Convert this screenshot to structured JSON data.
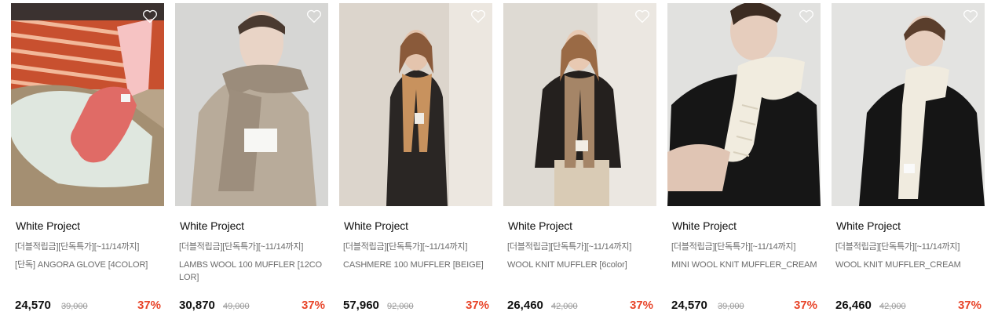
{
  "icons": {
    "wishlist": "heart-outline-icon"
  },
  "colors": {
    "discount": "#e8452a",
    "text": "#111111",
    "muted": "#6b6b6b",
    "strike": "#9a9a9a"
  },
  "products": [
    {
      "brand": "White Project",
      "promo": "[더블적립금][단독특가][~11/14까지]",
      "title": "[단독] ANGORA GLOVE [4COLOR]",
      "price": "24,570",
      "original_price": "39,000",
      "discount": "37%"
    },
    {
      "brand": "White Project",
      "promo": "[더블적립금][단독특가][~11/14까지]",
      "title": "LAMBS WOOL 100 MUFFLER [12COLOR]",
      "price": "30,870",
      "original_price": "49,000",
      "discount": "37%"
    },
    {
      "brand": "White Project",
      "promo": "[더블적립금][단독특가][~11/14까지]",
      "title": "CASHMERE 100 MUFFLER [BEIGE]",
      "price": "57,960",
      "original_price": "92,000",
      "discount": "37%"
    },
    {
      "brand": "White Project",
      "promo": "[더블적립금][단독특가][~11/14까지]",
      "title": "WOOL KNIT MUFFLER [6color]",
      "price": "26,460",
      "original_price": "42,000",
      "discount": "37%"
    },
    {
      "brand": "White Project",
      "promo": "[더블적립금][단독특가][~11/14까지]",
      "title": "MINI WOOL KNIT MUFFLER_CREAM",
      "price": "24,570",
      "original_price": "39,000",
      "discount": "37%"
    },
    {
      "brand": "White Project",
      "promo": "[더블적립금][단독특가][~11/14까지]",
      "title": "WOOL KNIT MUFFLER_CREAM",
      "price": "26,460",
      "original_price": "42,000",
      "discount": "37%"
    }
  ]
}
